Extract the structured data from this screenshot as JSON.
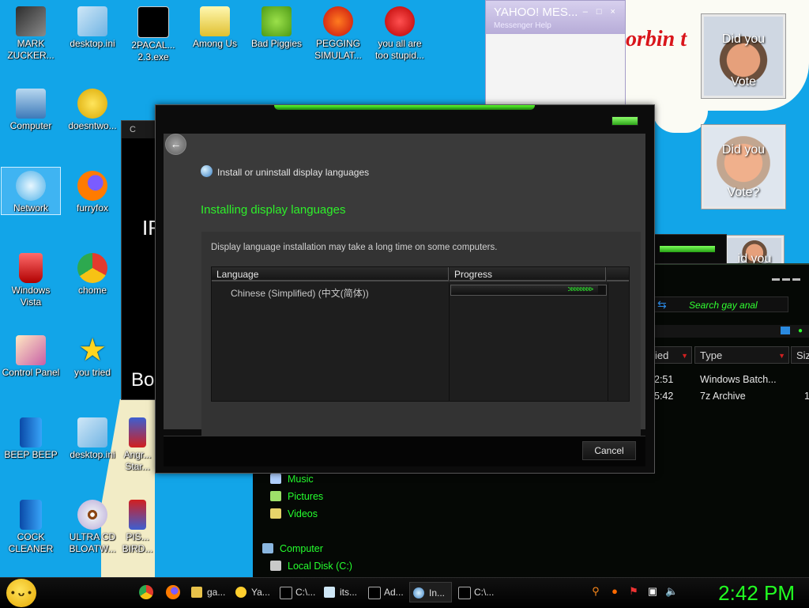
{
  "desktop_icons": [
    {
      "label": "MARK ZUCKER...",
      "name": "icon-mark-zucker"
    },
    {
      "label": "desktop.ini",
      "name": "icon-desktop-ini-1"
    },
    {
      "label": "2PACAL... 2.3.exe",
      "name": "icon-2pacal-exe"
    },
    {
      "label": "Among Us",
      "name": "icon-among-us"
    },
    {
      "label": "Bad Piggies",
      "name": "icon-bad-piggies"
    },
    {
      "label": "PEGGING SIMULAT...",
      "name": "icon-pegging-simulator"
    },
    {
      "label": "you all are too stupid...",
      "name": "icon-dev-cpp"
    },
    {
      "label": "Computer",
      "name": "icon-computer"
    },
    {
      "label": "doesntwo...",
      "name": "icon-doesntwork"
    },
    {
      "label": "Network",
      "name": "icon-network"
    },
    {
      "label": "furryfox",
      "name": "icon-furryfox"
    },
    {
      "label": "Windows Vista",
      "name": "icon-windows-vista"
    },
    {
      "label": "chome",
      "name": "icon-chome"
    },
    {
      "label": "Control Panel",
      "name": "icon-control-panel"
    },
    {
      "label": "you tried",
      "name": "icon-you-tried"
    },
    {
      "label": "BEEP BEEP",
      "name": "icon-beep-beep"
    },
    {
      "label": "desktop.ini",
      "name": "icon-desktop-ini-2"
    },
    {
      "label": "Angr... Star...",
      "name": "icon-angry-birds-star"
    },
    {
      "label": "COCK CLEANER",
      "name": "icon-cleaner"
    },
    {
      "label": "ULTRA CD BLOATW...",
      "name": "icon-ultra-cd"
    },
    {
      "label": "PIS... BIRD...",
      "name": "icon-birds"
    }
  ],
  "yahoo": {
    "logo": "YAHOO! MES...",
    "sub": "Messenger   Help"
  },
  "banner_text": "orbin t",
  "vote_cards": [
    {
      "top": "Did you",
      "bottom": "Vote"
    },
    {
      "top": "Did you",
      "bottom": "Vote?"
    },
    {
      "top": "id you",
      "bottom": ""
    }
  ],
  "cmd_window": {
    "title": "C",
    "text_1": "IF",
    "text_2": "Bo"
  },
  "explorer": {
    "search_placeholder": "Search gay anal",
    "columns": [
      "ied",
      "Type",
      "Siz"
    ],
    "rows": [
      {
        "modified": "2:51",
        "type": "Windows Batch..."
      },
      {
        "modified": "5:42",
        "type": "7z Archive",
        "size": "1"
      }
    ],
    "nav": [
      "Music",
      "Pictures",
      "Videos",
      "Computer",
      "Local Disk (C:)"
    ]
  },
  "dialog": {
    "title": "Install or uninstall display languages",
    "heading": "Installing display languages",
    "note": "Display language installation may take a long time on some computers.",
    "columns": [
      "Language",
      "Progress"
    ],
    "languages": [
      {
        "name": "Chinese (Simplified) (中文(简体))",
        "progress": 0.95
      }
    ],
    "cancel_label": "Cancel"
  },
  "taskbar": {
    "tasks": [
      "ga...",
      "Ya...",
      "C:\\...",
      "its...",
      "Ad...",
      "In...",
      "C:\\..."
    ],
    "clock": "2:42 PM"
  },
  "colors": {
    "accent": "#2ef02a",
    "desktop": "#12a5e8",
    "dark": "#0c0c0c"
  }
}
